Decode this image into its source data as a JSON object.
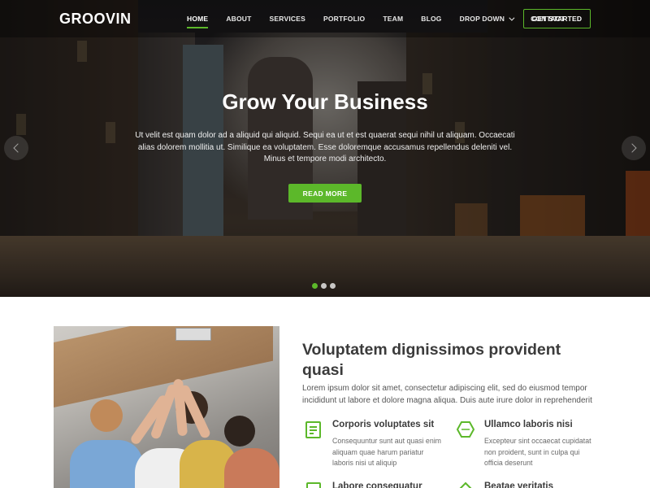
{
  "brand": {
    "logo": "GROOVIN",
    "accent": "#5cb82a"
  },
  "nav": {
    "items": [
      {
        "label": "HOME",
        "active": true
      },
      {
        "label": "ABOUT"
      },
      {
        "label": "SERVICES"
      },
      {
        "label": "PORTFOLIO"
      },
      {
        "label": "TEAM"
      },
      {
        "label": "BLOG"
      },
      {
        "label": "DROP DOWN",
        "icon": "chevron-down-icon"
      },
      {
        "label": "CONTACT"
      }
    ],
    "cta": "GET STARTED"
  },
  "hero": {
    "title": "Grow Your Business",
    "text": "Ut velit est quam dolor ad a aliquid qui aliquid. Sequi ea ut et est quaerat sequi nihil ut aliquam. Occaecati alias dolorem mollitia ut. Similique ea voluptatem. Esse doloremque accusamus repellendus deleniti vel. Minus et tempore modi architecto.",
    "button": "READ MORE",
    "prev_icon": "chevron-left-icon",
    "next_icon": "chevron-right-icon",
    "slide_count": 3,
    "active_slide": 1
  },
  "about": {
    "title": "Voluptatem dignissimos provident quasi",
    "text": "Lorem ipsum dolor sit amet, consectetur adipiscing elit, sed do eiusmod tempor incididunt ut labore et dolore magna aliqua. Duis aute irure dolor in reprehenderit",
    "features": [
      {
        "icon": "receipt-icon",
        "title": "Corporis voluptates sit",
        "text": "Consequuntur sunt aut quasi enim aliquam quae harum pariatur laboris nisi ut aliquip"
      },
      {
        "icon": "cube-icon",
        "title": "Ullamco laboris nisi",
        "text": "Excepteur sint occaecat cupidatat non proident, sunt in culpa qui officia deserunt"
      },
      {
        "icon": "document-icon",
        "title": "Labore consequatur",
        "text": ""
      },
      {
        "icon": "diamond-icon",
        "title": "Beatae veritatis",
        "text": ""
      }
    ]
  }
}
